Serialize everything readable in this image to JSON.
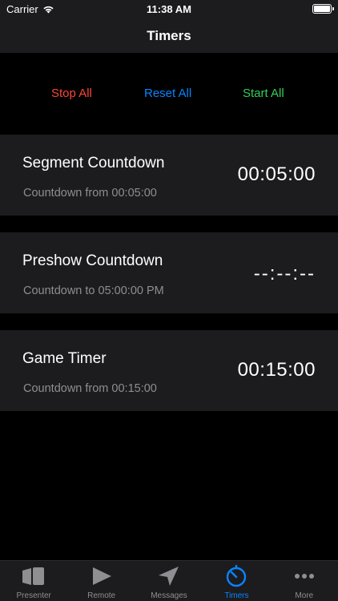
{
  "status_bar": {
    "carrier": "Carrier",
    "time": "11:38 AM",
    "icons": [
      "wifi-icon",
      "battery-icon"
    ]
  },
  "nav": {
    "title": "Timers"
  },
  "controls": {
    "stop_all": "Stop All",
    "reset_all": "Reset All",
    "start_all": "Start All"
  },
  "colors": {
    "stop": "#ff453a",
    "reset": "#0a84ff",
    "start": "#30d158",
    "accent": "#0a84ff"
  },
  "timers": [
    {
      "name": "Segment Countdown",
      "subtitle": "Countdown from 00:05:00",
      "value": "00:05:00"
    },
    {
      "name": "Preshow Countdown",
      "subtitle": "Countdown to 05:00:00 PM",
      "value": "--:--:--"
    },
    {
      "name": "Game Timer",
      "subtitle": "Countdown from 00:15:00",
      "value": "00:15:00"
    }
  ],
  "tabs": [
    {
      "label": "Presenter",
      "icon": "presenter-icon",
      "active": false
    },
    {
      "label": "Remote",
      "icon": "play-icon",
      "active": false
    },
    {
      "label": "Messages",
      "icon": "send-icon",
      "active": false
    },
    {
      "label": "Timers",
      "icon": "timer-icon",
      "active": true
    },
    {
      "label": "More",
      "icon": "more-icon",
      "active": false
    }
  ]
}
